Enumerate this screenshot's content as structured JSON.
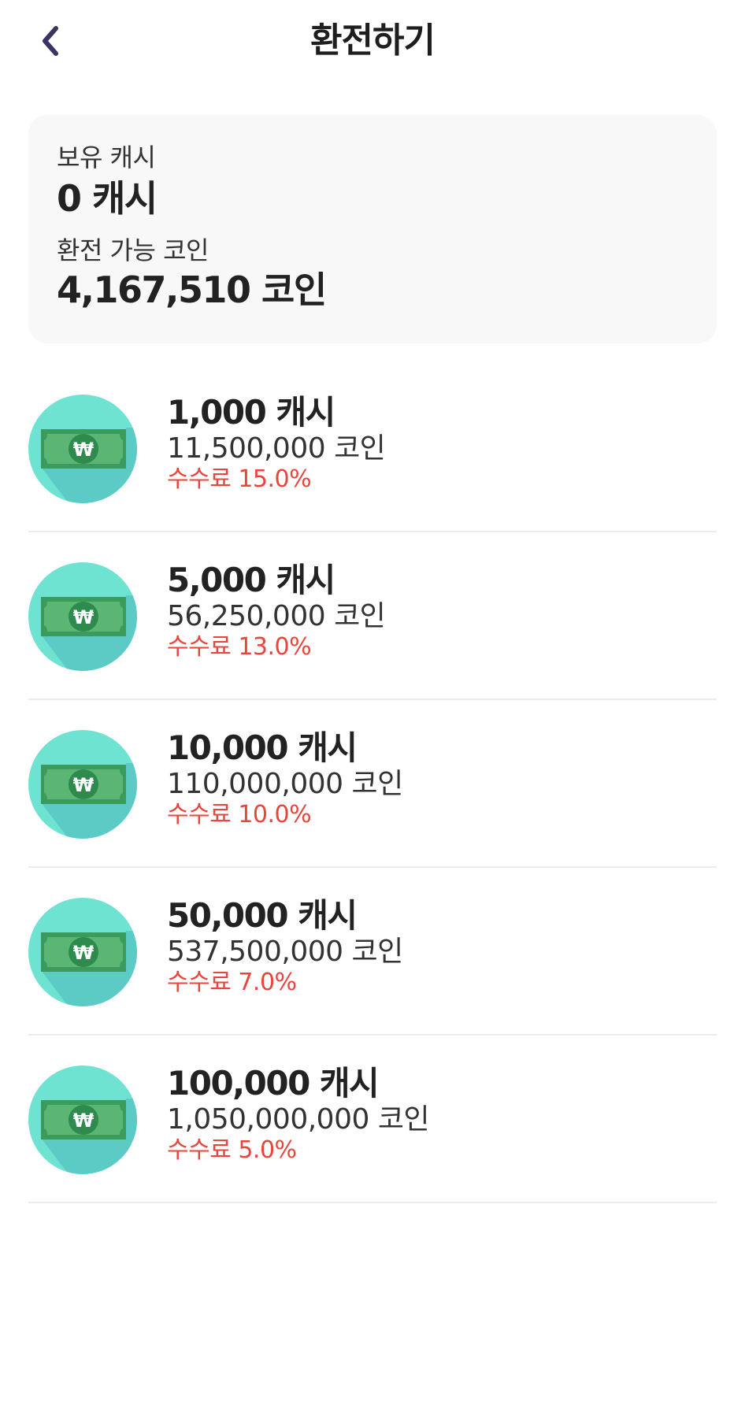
{
  "header": {
    "title": "환전하기",
    "back_icon": "chevron-left-icon"
  },
  "balance": {
    "cash_label": "보유 캐시",
    "cash_value": "0 캐시",
    "coin_label": "환전 가능 코인",
    "coin_value": "4,167,510 코인"
  },
  "exchange_options": [
    {
      "cash": "1,000 캐시",
      "coins": "11,500,000 코인",
      "fee": "수수료 15.0%",
      "icon": "banknote-won-icon"
    },
    {
      "cash": "5,000 캐시",
      "coins": "56,250,000 코인",
      "fee": "수수료 13.0%",
      "icon": "banknote-won-icon"
    },
    {
      "cash": "10,000 캐시",
      "coins": "110,000,000 코인",
      "fee": "수수료 10.0%",
      "icon": "banknote-won-icon"
    },
    {
      "cash": "50,000 캐시",
      "coins": "537,500,000 코인",
      "fee": "수수료 7.0%",
      "icon": "banknote-won-icon"
    },
    {
      "cash": "100,000 캐시",
      "coins": "1,050,000,000 코인",
      "fee": "수수료 5.0%",
      "icon": "banknote-won-icon"
    }
  ],
  "colors": {
    "fee": "#e8453c",
    "icon_circle": "#6ee3d2",
    "icon_shadow": "#5ccbc6",
    "banknote": "#3a9b5c",
    "banknote_inner": "#5ab672",
    "back_chevron": "#3b3566",
    "card_background": "#f8f8f8"
  }
}
